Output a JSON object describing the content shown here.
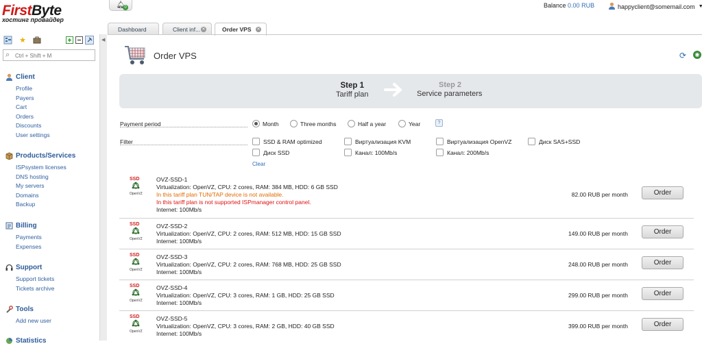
{
  "brand": {
    "name_part1": "First",
    "name_part2": "Byte",
    "tagline": "хостинг провайдер"
  },
  "search": {
    "placeholder": "Ctrl + Shift + M"
  },
  "sidebar": {
    "sections": [
      {
        "title": "Client",
        "icon": "user-icon",
        "items": [
          "Profile",
          "Payers",
          "Cart",
          "Orders",
          "Discounts",
          "User settings"
        ]
      },
      {
        "title": "Products/Services",
        "icon": "box-icon",
        "items": [
          "ISPsystem licenses",
          "DNS hosting",
          "My servers",
          "Domains",
          "Backup"
        ]
      },
      {
        "title": "Billing",
        "icon": "billing-icon",
        "items": [
          "Payments",
          "Expenses"
        ]
      },
      {
        "title": "Support",
        "icon": "headset-icon",
        "items": [
          "Support tickets",
          "Tickets archive"
        ]
      },
      {
        "title": "Tools",
        "icon": "tools-icon",
        "items": [
          "Add new user"
        ]
      },
      {
        "title": "Statistics",
        "icon": "stats-icon",
        "items": []
      }
    ]
  },
  "topbar": {
    "notifications_count": "0",
    "balance_label": "Balance",
    "balance_amount": "0.00 RUB",
    "user_email": "happyclient@somemail.com"
  },
  "tabs": [
    {
      "label": "Dashboard",
      "closable": false,
      "active": false
    },
    {
      "label": "Client inf...",
      "closable": true,
      "active": false
    },
    {
      "label": "Order VPS",
      "closable": true,
      "active": true
    }
  ],
  "page": {
    "title": "Order VPS"
  },
  "wizard": {
    "step1_num": "Step 1",
    "step1_label": "Tariff plan",
    "step2_num": "Step 2",
    "step2_label": "Service parameters"
  },
  "form": {
    "period_label": "Payment period",
    "periods": [
      "Month",
      "Three months",
      "Half a year",
      "Year"
    ],
    "selected_period": "Month",
    "help_label": "?",
    "filter_label": "Filter",
    "filters": [
      "SSD & RAM optimized",
      "Виртуализация KVM",
      "Виртуализация OpenVZ",
      "Диск SAS+SSD",
      "Диск SSD",
      "Канал: 100Mb/s",
      "Канал: 200Mb/s"
    ],
    "clear_label": "Clear"
  },
  "tariffs": [
    {
      "name": "OVZ-SSD-1",
      "specs": "Virtualization: OpenVZ, CPU: 2 cores, RAM: 384 MB, HDD: 6 GB SSD",
      "warning_orange": "In this tariff plan TUN/TAP device is not available.",
      "warning_red": "In this tariff plan is not supported ISPmanager control panel.",
      "internet": "Internet: 100Mb/s",
      "price": "82.00 RUB per month",
      "button": "Order"
    },
    {
      "name": "OVZ-SSD-2",
      "specs": "Virtualization: OpenVZ, CPU: 2 cores, RAM: 512 MB, HDD: 15 GB SSD",
      "internet": "Internet: 100Mb/s",
      "price": "149.00 RUB per month",
      "button": "Order"
    },
    {
      "name": "OVZ-SSD-3",
      "specs": "Virtualization: OpenVZ, CPU: 2 cores, RAM: 768 MB, HDD: 25 GB SSD",
      "internet": "Internet: 100Mb/s",
      "price": "248.00 RUB per month",
      "button": "Order"
    },
    {
      "name": "OVZ-SSD-4",
      "specs": "Virtualization: OpenVZ, CPU: 3 cores, RAM: 1 GB, HDD: 25 GB SSD",
      "internet": "Internet: 100Mb/s",
      "price": "299.00 RUB per month",
      "button": "Order"
    },
    {
      "name": "OVZ-SSD-5",
      "specs": "Virtualization: OpenVZ, CPU: 3 cores, RAM: 2 GB, HDD: 40 GB SSD",
      "internet": "Internet: 100Mb/s",
      "price": "399.00 RUB per month",
      "button": "Order"
    }
  ],
  "tariff_logo": {
    "badge": "SSD",
    "caption": "OpenVZ"
  },
  "colors": {
    "link": "#2f5f9f",
    "section_title": "#2c5b99",
    "warning_orange": "#e06a00",
    "warning_red": "#e01010",
    "wizard_bg": "#e5e8eb"
  }
}
